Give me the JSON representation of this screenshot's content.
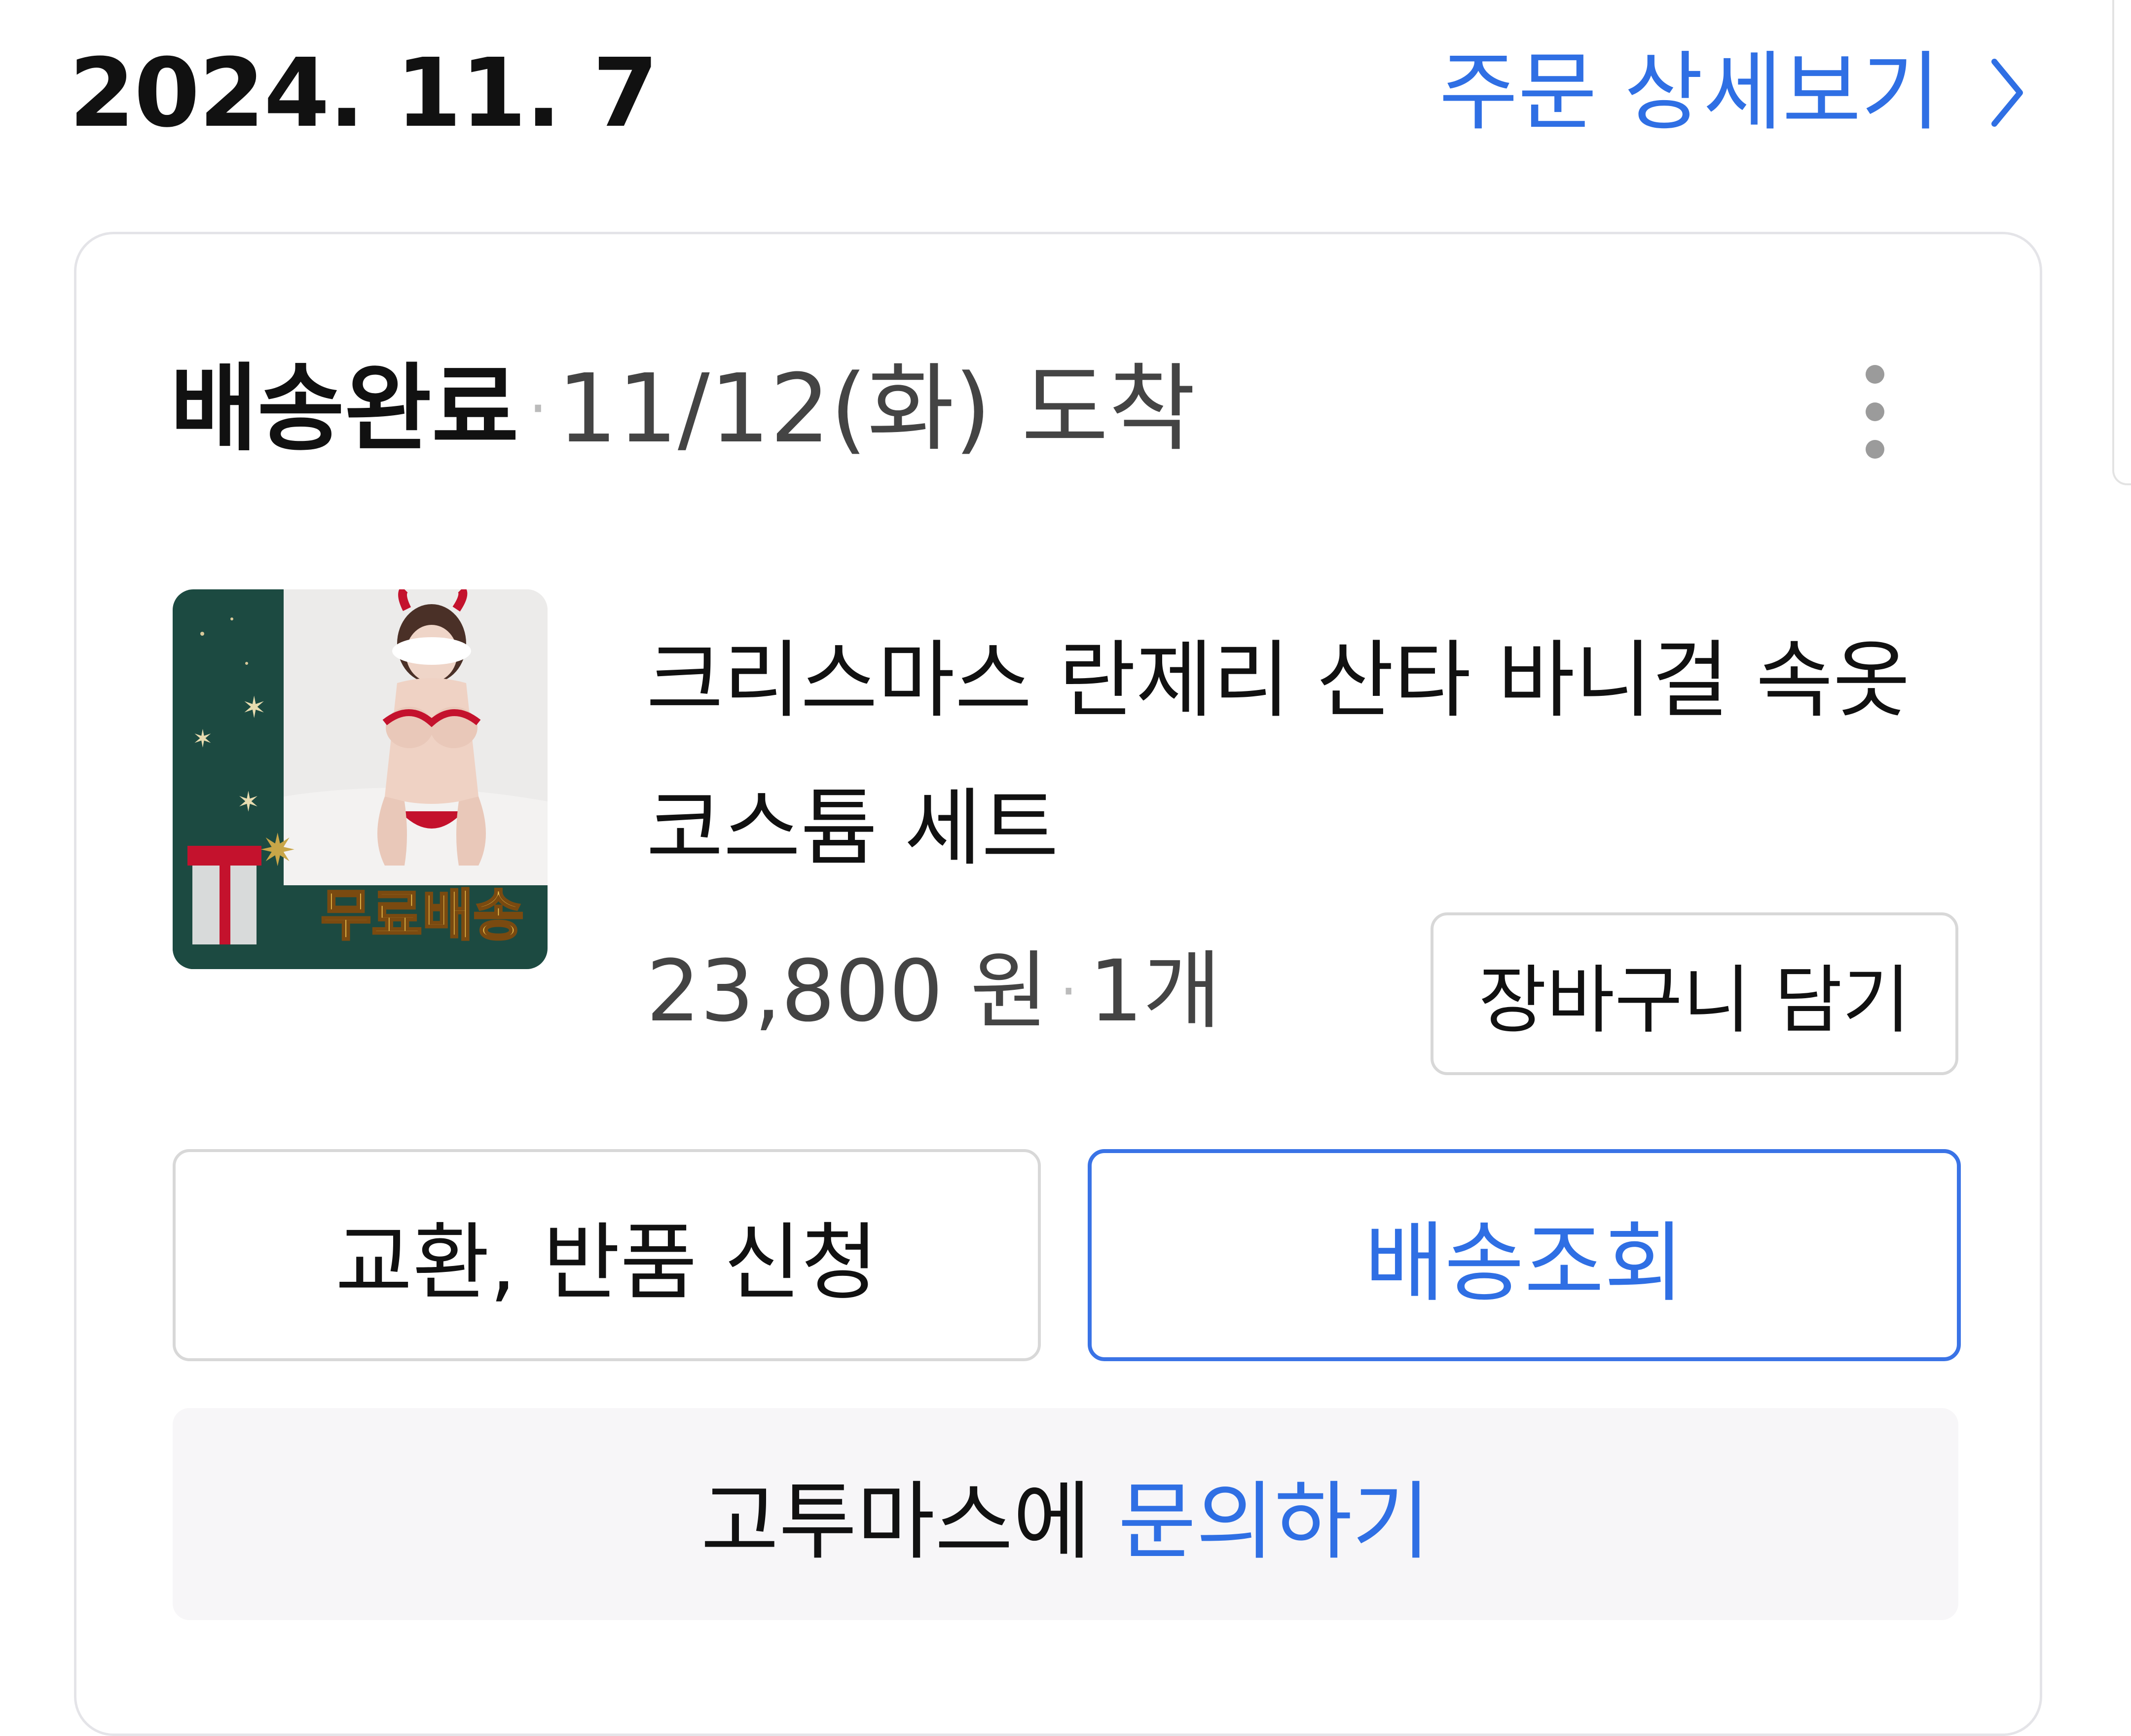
{
  "header": {
    "date": "2024. 11. 7",
    "order_detail_label": "주문 상세보기"
  },
  "card": {
    "status": "배송완료",
    "separator": "·",
    "arrival": "11/12(화) 도착",
    "product": {
      "name": "크리스마스 란제리 산타 바니걸 속옷 코스튬 세트",
      "image_badge": "무료배송",
      "price": "23,800 원",
      "quantity": "1개"
    },
    "buttons": {
      "add_to_cart": "장바구니 담기",
      "exchange_return": "교환, 반품 신청",
      "track_delivery": "배송조회"
    },
    "inquiry": {
      "seller": "고투마스에",
      "action": "문의하기"
    }
  },
  "icons": {
    "chevron": "chevron-right-icon",
    "more": "more-vertical-icon"
  },
  "colors": {
    "accent": "#2f6fe4",
    "card_border": "#e4e4e8",
    "inquiry_bg": "#f7f6f8",
    "thumbnail_green": "#1c4a41"
  }
}
